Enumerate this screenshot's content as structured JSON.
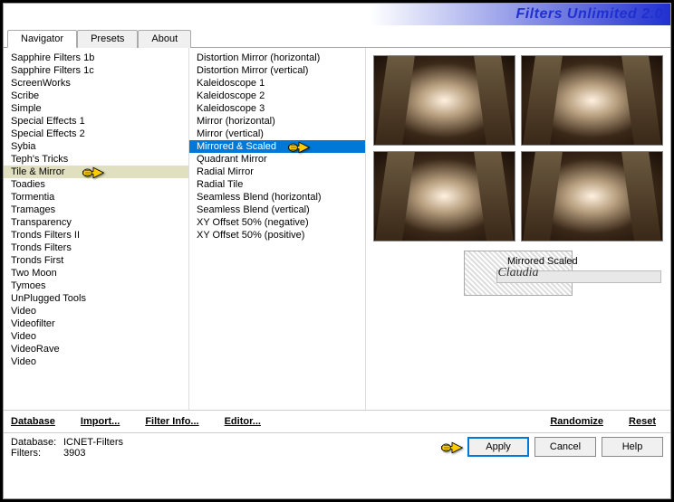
{
  "title": "Filters Unlimited 2.0",
  "tabs": [
    "Navigator",
    "Presets",
    "About"
  ],
  "activeTab": 0,
  "categories": [
    "Sapphire Filters 1b",
    "Sapphire Filters 1c",
    "ScreenWorks",
    "Scribe",
    "Simple",
    "Special Effects 1",
    "Special Effects 2",
    "Sybia",
    "Teph's Tricks",
    "Tile & Mirror",
    "Toadies",
    "Tormentia",
    "Tramages",
    "Transparency",
    "Tronds Filters II",
    "Tronds Filters",
    "Tronds First",
    "Two Moon",
    "Tymoes",
    "UnPlugged Tools",
    "Video",
    "Videofilter",
    "Video",
    "VideoRave",
    "Video"
  ],
  "categorySelectedIndex": 9,
  "filters": [
    "Distortion Mirror (horizontal)",
    "Distortion Mirror (vertical)",
    "Kaleidoscope 1",
    "Kaleidoscope 2",
    "Kaleidoscope 3",
    "Mirror (horizontal)",
    "Mirror (vertical)",
    "Mirrored & Scaled",
    "Quadrant Mirror",
    "Radial Mirror",
    "Radial Tile",
    "Seamless Blend (horizontal)",
    "Seamless Blend (vertical)",
    "XY Offset 50% (negative)",
    "XY Offset 50% (positive)"
  ],
  "filterSelectedIndex": 7,
  "currentFilterLabel": "Mirrored  Scaled",
  "watermark": "Claudia",
  "btnrow1": {
    "database": "Database",
    "import": "Import...",
    "filterinfo": "Filter Info...",
    "editor": "Editor...",
    "randomize": "Randomize",
    "reset": "Reset"
  },
  "status": {
    "dbLabel": "Database:",
    "dbVal": "ICNET-Filters",
    "filtersLabel": "Filters:",
    "filtersVal": "3903"
  },
  "btnrow2": {
    "apply": "Apply",
    "cancel": "Cancel",
    "help": "Help"
  }
}
